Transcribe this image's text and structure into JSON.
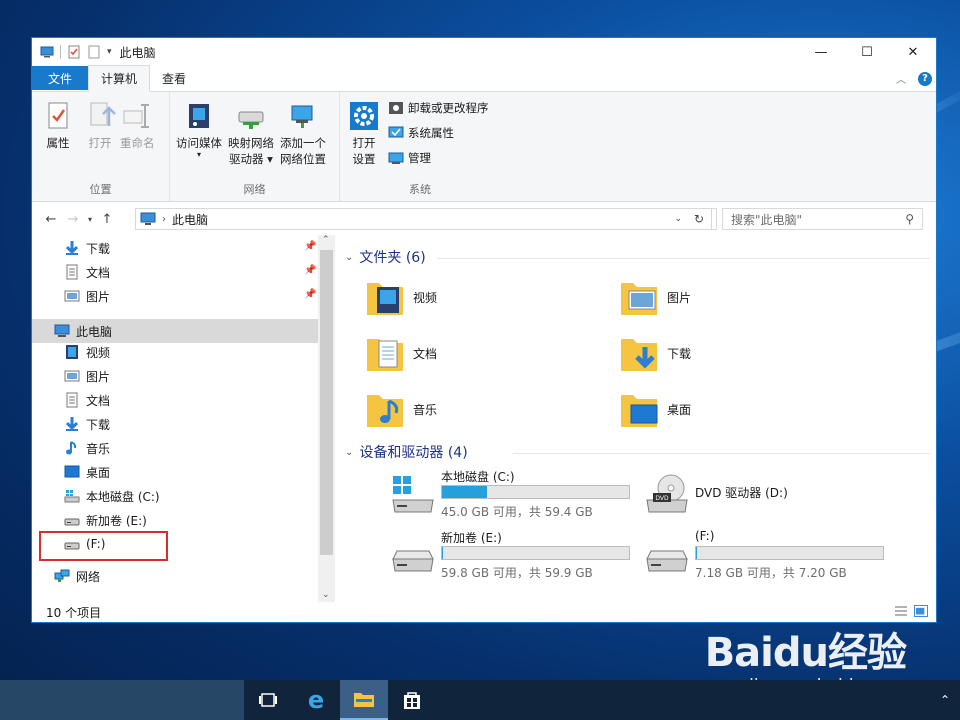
{
  "window": {
    "title": "此电脑",
    "minimize_glyph": "—",
    "maximize_glyph": "☐",
    "close_glyph": "✕"
  },
  "tabs": [
    {
      "label": "文件"
    },
    {
      "label": "计算机"
    },
    {
      "label": "查看"
    }
  ],
  "ribbon": {
    "location_group": {
      "label": "位置",
      "properties": "属性",
      "open": "打开",
      "rename": "重命名"
    },
    "network_group": {
      "label": "网络",
      "access_media": "访问媒体",
      "map_drive_1": "映射网络",
      "map_drive_2": "驱动器",
      "add_location_1": "添加一个",
      "add_location_2": "网络位置"
    },
    "system_group": {
      "label": "系统",
      "open_settings_1": "打开",
      "open_settings_2": "设置",
      "uninstall": "卸载或更改程序",
      "system_properties": "系统属性",
      "manage": "管理"
    }
  },
  "address": {
    "path": "此电脑",
    "search_placeholder": "搜索\"此电脑\""
  },
  "nav": {
    "quick_access": [
      {
        "label": "下载"
      },
      {
        "label": "文档"
      },
      {
        "label": "图片"
      }
    ],
    "this_pc": "此电脑",
    "pc_items": [
      {
        "label": "视频"
      },
      {
        "label": "图片"
      },
      {
        "label": "文档"
      },
      {
        "label": "下载"
      },
      {
        "label": "音乐"
      },
      {
        "label": "桌面"
      },
      {
        "label": "本地磁盘 (C:)"
      },
      {
        "label": "新加卷 (E:)"
      },
      {
        "label": "(F:)"
      }
    ],
    "network": "网络"
  },
  "content": {
    "folders_header": "文件夹 (6)",
    "folders": [
      {
        "label": "视频"
      },
      {
        "label": "图片"
      },
      {
        "label": "文档"
      },
      {
        "label": "下载"
      },
      {
        "label": "音乐"
      },
      {
        "label": "桌面"
      }
    ],
    "drives_header": "设备和驱动器 (4)",
    "drives": [
      {
        "name": "本地磁盘 (C:)",
        "free": "45.0 GB 可用，共 59.4 GB",
        "used_fraction": 0.24
      },
      {
        "name": "DVD 驱动器 (D:)",
        "free": "",
        "used_fraction": null
      },
      {
        "name": "新加卷 (E:)",
        "free": "59.8 GB 可用，共 59.9 GB",
        "used_fraction": 0.002
      },
      {
        "name": "(F:)",
        "free": "7.18 GB 可用，共 7.20 GB",
        "used_fraction": 0.003
      }
    ]
  },
  "status": {
    "item_count": "10 个项目"
  },
  "watermark": {
    "logo": "Baidu经验",
    "url": "jingyan.baidu.com"
  },
  "colors": {
    "accent": "#1979ca",
    "drive_bar": "#26a0da",
    "highlight_box": "#d32f2f",
    "taskbar": "#10253c"
  }
}
